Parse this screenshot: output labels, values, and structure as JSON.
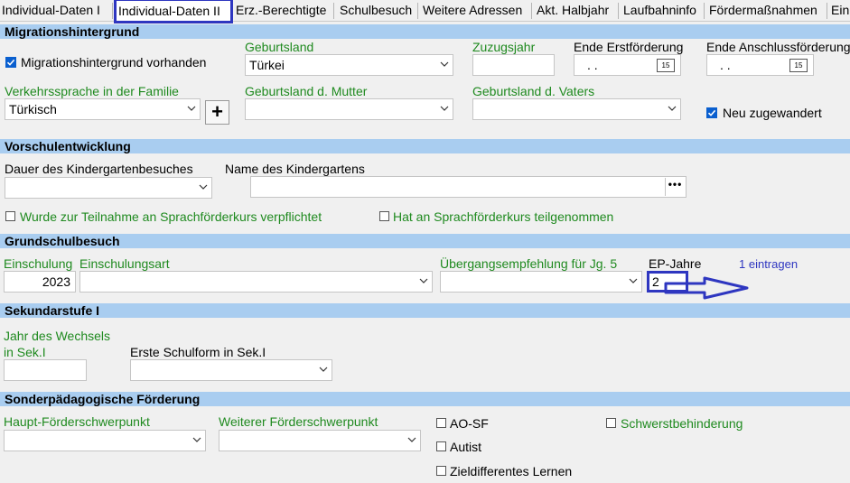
{
  "tabs": [
    "Individual-Daten I",
    "Individual-Daten II",
    "Erz.-Berechtigte",
    "Schulbesuch",
    "Weitere Adressen",
    "Akt. Halbjahr",
    "Laufbahninfo",
    "Fördermaßnahmen",
    "Ein"
  ],
  "sections": {
    "migration": "Migrationshintergrund",
    "vorschule": "Vorschulentwicklung",
    "grundschule": "Grundschulbesuch",
    "sek1": "Sekundarstufe I",
    "sonder": "Sonderpädagogische Förderung"
  },
  "migration": {
    "vorhanden_label": "Migrationshintergrund vorhanden",
    "geburtsland_label": "Geburtsland",
    "geburtsland_value": "Türkei",
    "zuzugsjahr_label": "Zuzugsjahr",
    "zuzugsjahr_value": "",
    "ende_erst_label": "Ende Erstförderung",
    "ende_erst_value": ". .",
    "ende_anschluss_label": "Ende Anschlussförderung",
    "ende_anschluss_value": ". .",
    "verkehrssprache_label": "Verkehrssprache in der Familie",
    "verkehrssprache_value": "Türkisch",
    "geb_mutter_label": "Geburtsland d. Mutter",
    "geb_vater_label": "Geburtsland d. Vaters",
    "neu_label": "Neu zugewandert",
    "plus": "+"
  },
  "vorschule": {
    "dauer_label": "Dauer des Kindergartenbesuches",
    "name_label": "Name des Kindergartens",
    "dots": "•••",
    "verpflichtet_label": "Wurde zur Teilnahme an Sprachförderkurs verpflichtet",
    "teilgenommen_label": "Hat an Sprachförderkurs teilgenommen"
  },
  "grundschule": {
    "einschulung_label": "Einschulung",
    "einschulung_value": "2023",
    "art_label": "Einschulungsart",
    "empfehlung_label": "Übergangsempfehlung für Jg. 5",
    "ep_label": "EP-Jahre",
    "ep_value": "2",
    "eintragen": "1 eintragen"
  },
  "sek1": {
    "wechsel_label_1": "Jahr des Wechsels",
    "wechsel_label_2": "in Sek.I",
    "schulform_label": "Erste Schulform in Sek.I"
  },
  "sonder": {
    "haupt_label": "Haupt-Förderschwerpunkt",
    "weiter_label": "Weiterer Förderschwerpunkt",
    "aosf_label": "AO-SF",
    "autist_label": "Autist",
    "ziel_label": "Zieldifferentes Lernen",
    "schwerst_label": "Schwerstbehinderung"
  },
  "colors": {
    "section_bg": "#a9cdf0",
    "green_label": "#1f8a1f",
    "annotation": "#2e36c0",
    "checkbox_on": "#0a5fcf"
  }
}
